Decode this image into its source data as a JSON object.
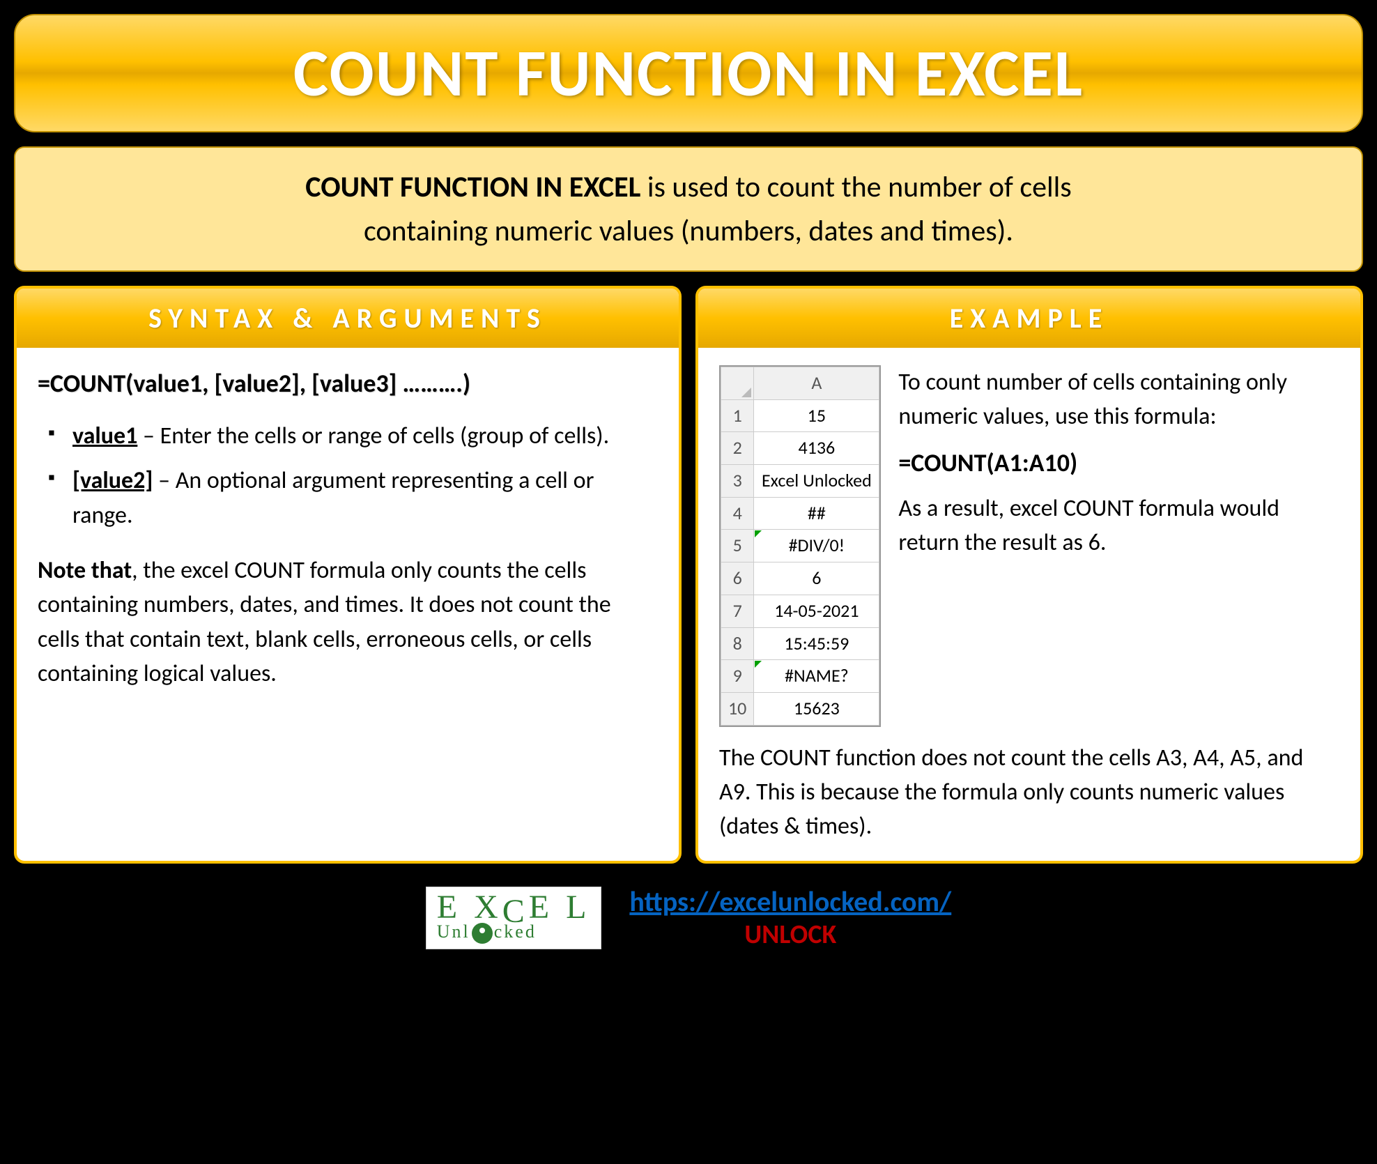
{
  "title": "COUNT FUNCTION IN EXCEL",
  "description": {
    "bold": "COUNT FUNCTION IN EXCEL",
    "rest1": " is used to count the number of cells",
    "line2": "containing numeric values (numbers, dates and times)."
  },
  "syntax": {
    "header": "SYNTAX & ARGUMENTS",
    "formula": "=COUNT(value1, [value2], [value3] ……….)",
    "args": [
      {
        "name": "value1",
        "text": " – Enter the cells or range of cells (group of cells)."
      },
      {
        "name": "[value2]",
        "text": " – An optional argument representing a cell or range."
      }
    ],
    "note_bold": "Note that",
    "note_rest": ", the excel COUNT formula only counts the cells containing numbers, dates, and times. It does not count the cells that contain text, blank cells, erroneous cells, or cells containing logical values."
  },
  "example": {
    "header": "EXAMPLE",
    "sheet": {
      "col_label": "A",
      "rows": [
        {
          "n": "1",
          "v": "15",
          "tri": false
        },
        {
          "n": "2",
          "v": "4136",
          "tri": false
        },
        {
          "n": "3",
          "v": "Excel Unlocked",
          "tri": false
        },
        {
          "n": "4",
          "v": "##",
          "tri": false
        },
        {
          "n": "5",
          "v": "#DIV/0!",
          "tri": true
        },
        {
          "n": "6",
          "v": "6",
          "tri": false
        },
        {
          "n": "7",
          "v": "14-05-2021",
          "tri": false
        },
        {
          "n": "8",
          "v": "15:45:59",
          "tri": false
        },
        {
          "n": "9",
          "v": "#NAME?",
          "tri": true
        },
        {
          "n": "10",
          "v": "15623",
          "tri": false
        }
      ]
    },
    "intro": "To count number of cells containing only numeric values, use this formula:",
    "formula": "=COUNT(A1:A10)",
    "result": "As a result, excel COUNT formula would return the result as 6.",
    "below": "The COUNT function does not count the cells A3, A4, A5, and A9. This is because the formula only counts numeric values (dates & times)."
  },
  "footer": {
    "logo": {
      "top": "EXCEL",
      "bottom": "Unlocked"
    },
    "url": "https://excelunlocked.com/",
    "unlock": "UNLOCK"
  }
}
